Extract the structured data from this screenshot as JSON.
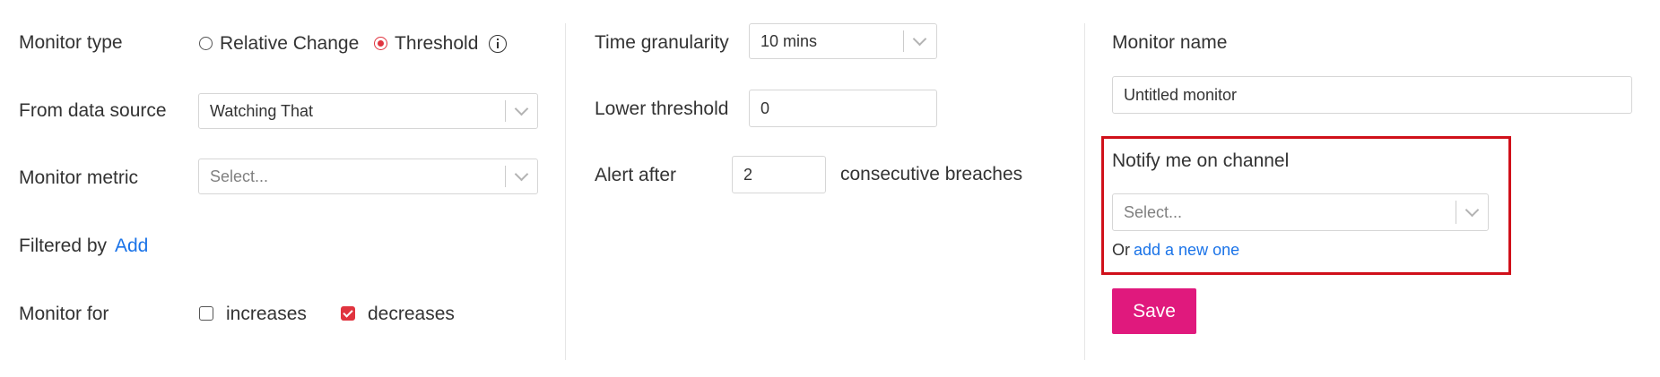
{
  "left_panel": {
    "monitor_type": {
      "label": "Monitor type",
      "options": [
        {
          "label": "Relative Change",
          "selected": false
        },
        {
          "label": "Threshold",
          "selected": true
        }
      ],
      "info_icon": "info-icon"
    },
    "data_source": {
      "label": "From data source",
      "value": "Watching That"
    },
    "metric": {
      "label": "Monitor metric",
      "placeholder": "Select..."
    },
    "filter": {
      "label": "Filtered by",
      "add_link": "Add"
    },
    "monitor_for": {
      "label": "Monitor for",
      "options": [
        {
          "label": "increases",
          "checked": false
        },
        {
          "label": "decreases",
          "checked": true
        }
      ]
    }
  },
  "middle_panel": {
    "granularity": {
      "label": "Time granularity",
      "value": "10 mins"
    },
    "lower_threshold": {
      "label": "Lower threshold",
      "value": "0"
    },
    "alert_after": {
      "label": "Alert after",
      "value": "2",
      "suffix": "consecutive breaches"
    }
  },
  "right_panel": {
    "monitor_name": {
      "label": "Monitor name",
      "value": "Untitled monitor"
    },
    "notify": {
      "label": "Notify me on channel",
      "placeholder": "Select...",
      "or_text": "Or",
      "add_link": "add a new one"
    },
    "save_label": "Save"
  },
  "colors": {
    "accent_radio": "#e0343f",
    "link": "#1a73e8",
    "save_button": "#e0197d",
    "highlight_border": "#d0101a"
  }
}
